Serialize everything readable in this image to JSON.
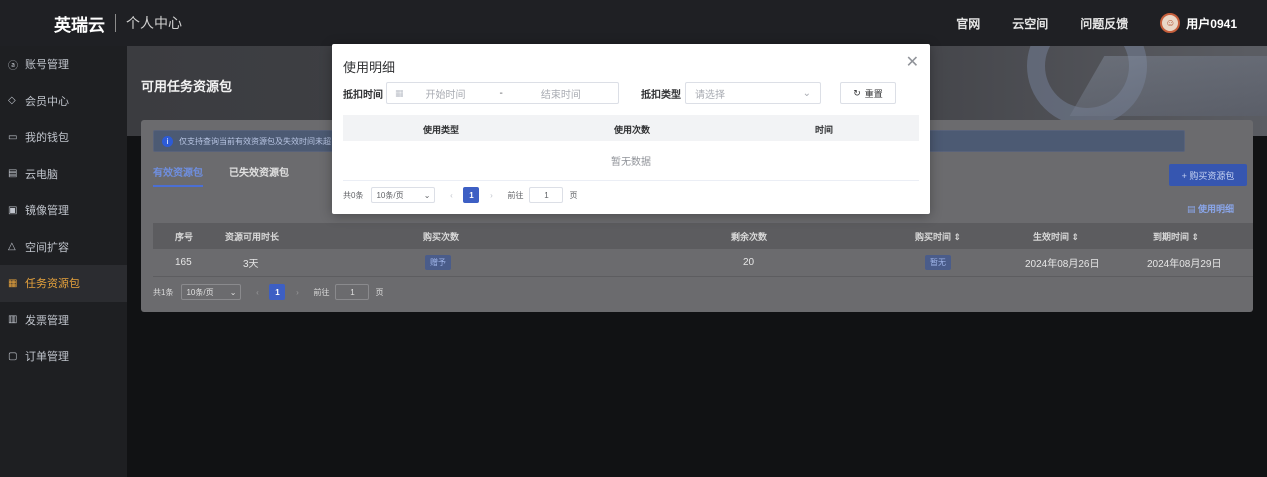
{
  "header": {
    "logo": "英瑞云",
    "subtitle": "个人中心",
    "links": [
      "官网",
      "云空间",
      "问题反馈"
    ],
    "user": "用户0941"
  },
  "sidebar": {
    "items": [
      {
        "icon": "user-icon",
        "label": "账号管理"
      },
      {
        "icon": "diamond-icon",
        "label": "会员中心"
      },
      {
        "icon": "wallet-icon",
        "label": "我的钱包"
      },
      {
        "icon": "computer-icon",
        "label": "云电脑"
      },
      {
        "icon": "image-icon",
        "label": "镜像管理"
      },
      {
        "icon": "cloud-icon",
        "label": "空间扩容"
      },
      {
        "icon": "package-icon",
        "label": "任务资源包"
      },
      {
        "icon": "invoice-icon",
        "label": "发票管理"
      },
      {
        "icon": "order-icon",
        "label": "订单管理"
      }
    ],
    "active_index": 6
  },
  "page": {
    "title": "可用任务资源包",
    "notice": "仅支持查询当前有效资源包及失效时间未超",
    "tabs": [
      "有效资源包",
      "已失效资源包"
    ],
    "buy_button": "+ 购买资源包",
    "usage_link": "使用明细",
    "columns": [
      "序号",
      "资源可用时长",
      "购买次数",
      "剩余次数",
      "购买时间 ⇕",
      "生效时间 ⇕",
      "到期时间 ⇕"
    ],
    "rows": [
      {
        "id": "165",
        "duration": "3天",
        "purchase": "赠予",
        "remaining": "20",
        "buy_time": "暂无",
        "start": "2024年08月26日",
        "end": "2024年08月29日"
      }
    ],
    "pager": {
      "total": "共1条",
      "page_size": "10条/页",
      "current": "1",
      "goto_label": "前往",
      "goto_value": "1",
      "page_unit": "页"
    }
  },
  "modal": {
    "title": "使用明细",
    "filter": {
      "time_label": "抵扣时间",
      "start_placeholder": "开始时间",
      "dash": "-",
      "end_placeholder": "结束时间",
      "type_label": "抵扣类型",
      "type_placeholder": "请选择",
      "reset": "重置"
    },
    "columns": [
      "使用类型",
      "使用次数",
      "时间"
    ],
    "empty_text": "暂无数据",
    "pager": {
      "total": "共0条",
      "page_size": "10条/页",
      "current": "1",
      "goto_label": "前往",
      "goto_value": "1",
      "page_unit": "页"
    }
  }
}
